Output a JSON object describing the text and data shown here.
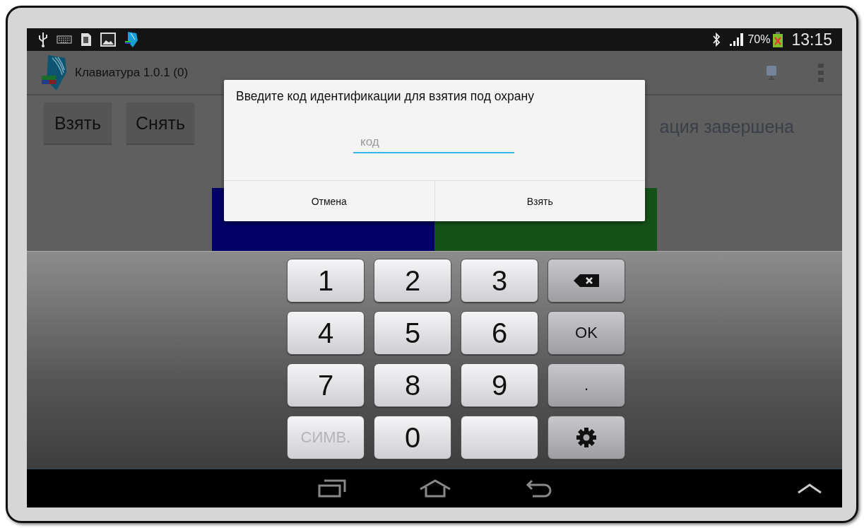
{
  "status_bar": {
    "battery_percent": "70%",
    "time": "13:15"
  },
  "app_bar": {
    "title": "Клавиатура 1.0.1 (0)"
  },
  "actions": [
    {
      "label": "Взять"
    },
    {
      "label": "Снять"
    }
  ],
  "status_text": "ация завершена",
  "tiles": [
    {
      "color": "#000066"
    },
    {
      "color": "#15521a"
    }
  ],
  "dialog": {
    "message": "Введите код идентификации для взятия под охрану",
    "field": {
      "placeholder": "код"
    },
    "buttons": [
      "Отмена",
      "Взять"
    ]
  },
  "keypad": {
    "keys": [
      {
        "kind": "char",
        "label": "1",
        "disabled": false
      },
      {
        "kind": "char",
        "label": "2",
        "disabled": false
      },
      {
        "kind": "char",
        "label": "3",
        "disabled": false
      },
      {
        "kind": "backspace",
        "disabled": false
      },
      {
        "kind": "char",
        "label": "4",
        "disabled": false
      },
      {
        "kind": "char",
        "label": "5",
        "disabled": false
      },
      {
        "kind": "char",
        "label": "6",
        "disabled": false
      },
      {
        "kind": "fn",
        "label": "OK",
        "disabled": false
      },
      {
        "kind": "char",
        "label": "7",
        "disabled": false
      },
      {
        "kind": "char",
        "label": "8",
        "disabled": false
      },
      {
        "kind": "char",
        "label": "9",
        "disabled": false
      },
      {
        "kind": "fn",
        "label": ".",
        "disabled": false
      },
      {
        "kind": "char",
        "label": "СИМВ.",
        "disabled": true
      },
      {
        "kind": "char",
        "label": "0",
        "disabled": false
      },
      {
        "kind": "blank",
        "disabled": false
      },
      {
        "kind": "settings",
        "disabled": false
      }
    ]
  }
}
